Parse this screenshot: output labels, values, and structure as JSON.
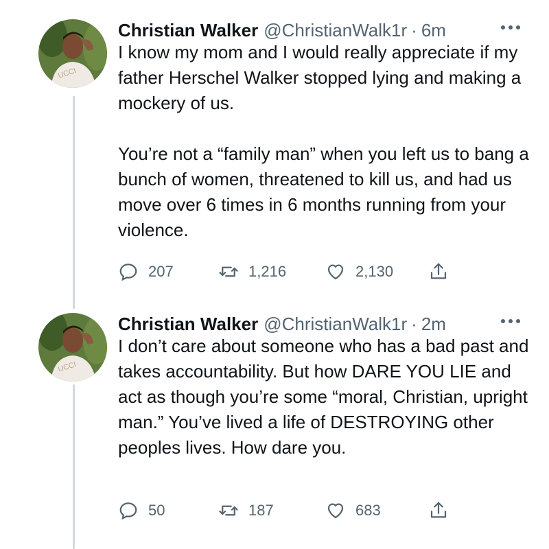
{
  "tweets": [
    {
      "author": {
        "name": "Christian Walker",
        "handle": "@ChristianWalk1r",
        "avatar_icon": "profile-photo-icon"
      },
      "separator": "·",
      "time": "6m",
      "text": "I know my mom and I would really appreciate if my father Herschel Walker stopped lying and making a mockery of us.\n\nYou’re not a “family man” when you left us to bang a bunch of women, threatened to kill us, and had us move over 6 times in 6 months running from your violence.",
      "stats": {
        "replies": "207",
        "retweets": "1,216",
        "likes": "2,130"
      }
    },
    {
      "author": {
        "name": "Christian Walker",
        "handle": "@ChristianWalk1r",
        "avatar_icon": "profile-photo-icon"
      },
      "separator": "·",
      "time": "2m",
      "text": "I don’t care about someone who has a bad past and takes accountability. But how DARE YOU LIE and act as though you’re some “moral, Christian, upright man.” You’ve lived a life of DESTROYING other peoples lives. How dare you.",
      "stats": {
        "replies": "50",
        "retweets": "187",
        "likes": "683"
      }
    }
  ],
  "icons": {
    "reply": "reply-icon",
    "retweet": "retweet-icon",
    "like": "heart-icon",
    "share": "share-icon",
    "more": "more-options-icon"
  },
  "colors": {
    "text": "#0f1419",
    "secondary": "#536471",
    "thread_line": "#cfd9de",
    "background": "#ffffff"
  }
}
